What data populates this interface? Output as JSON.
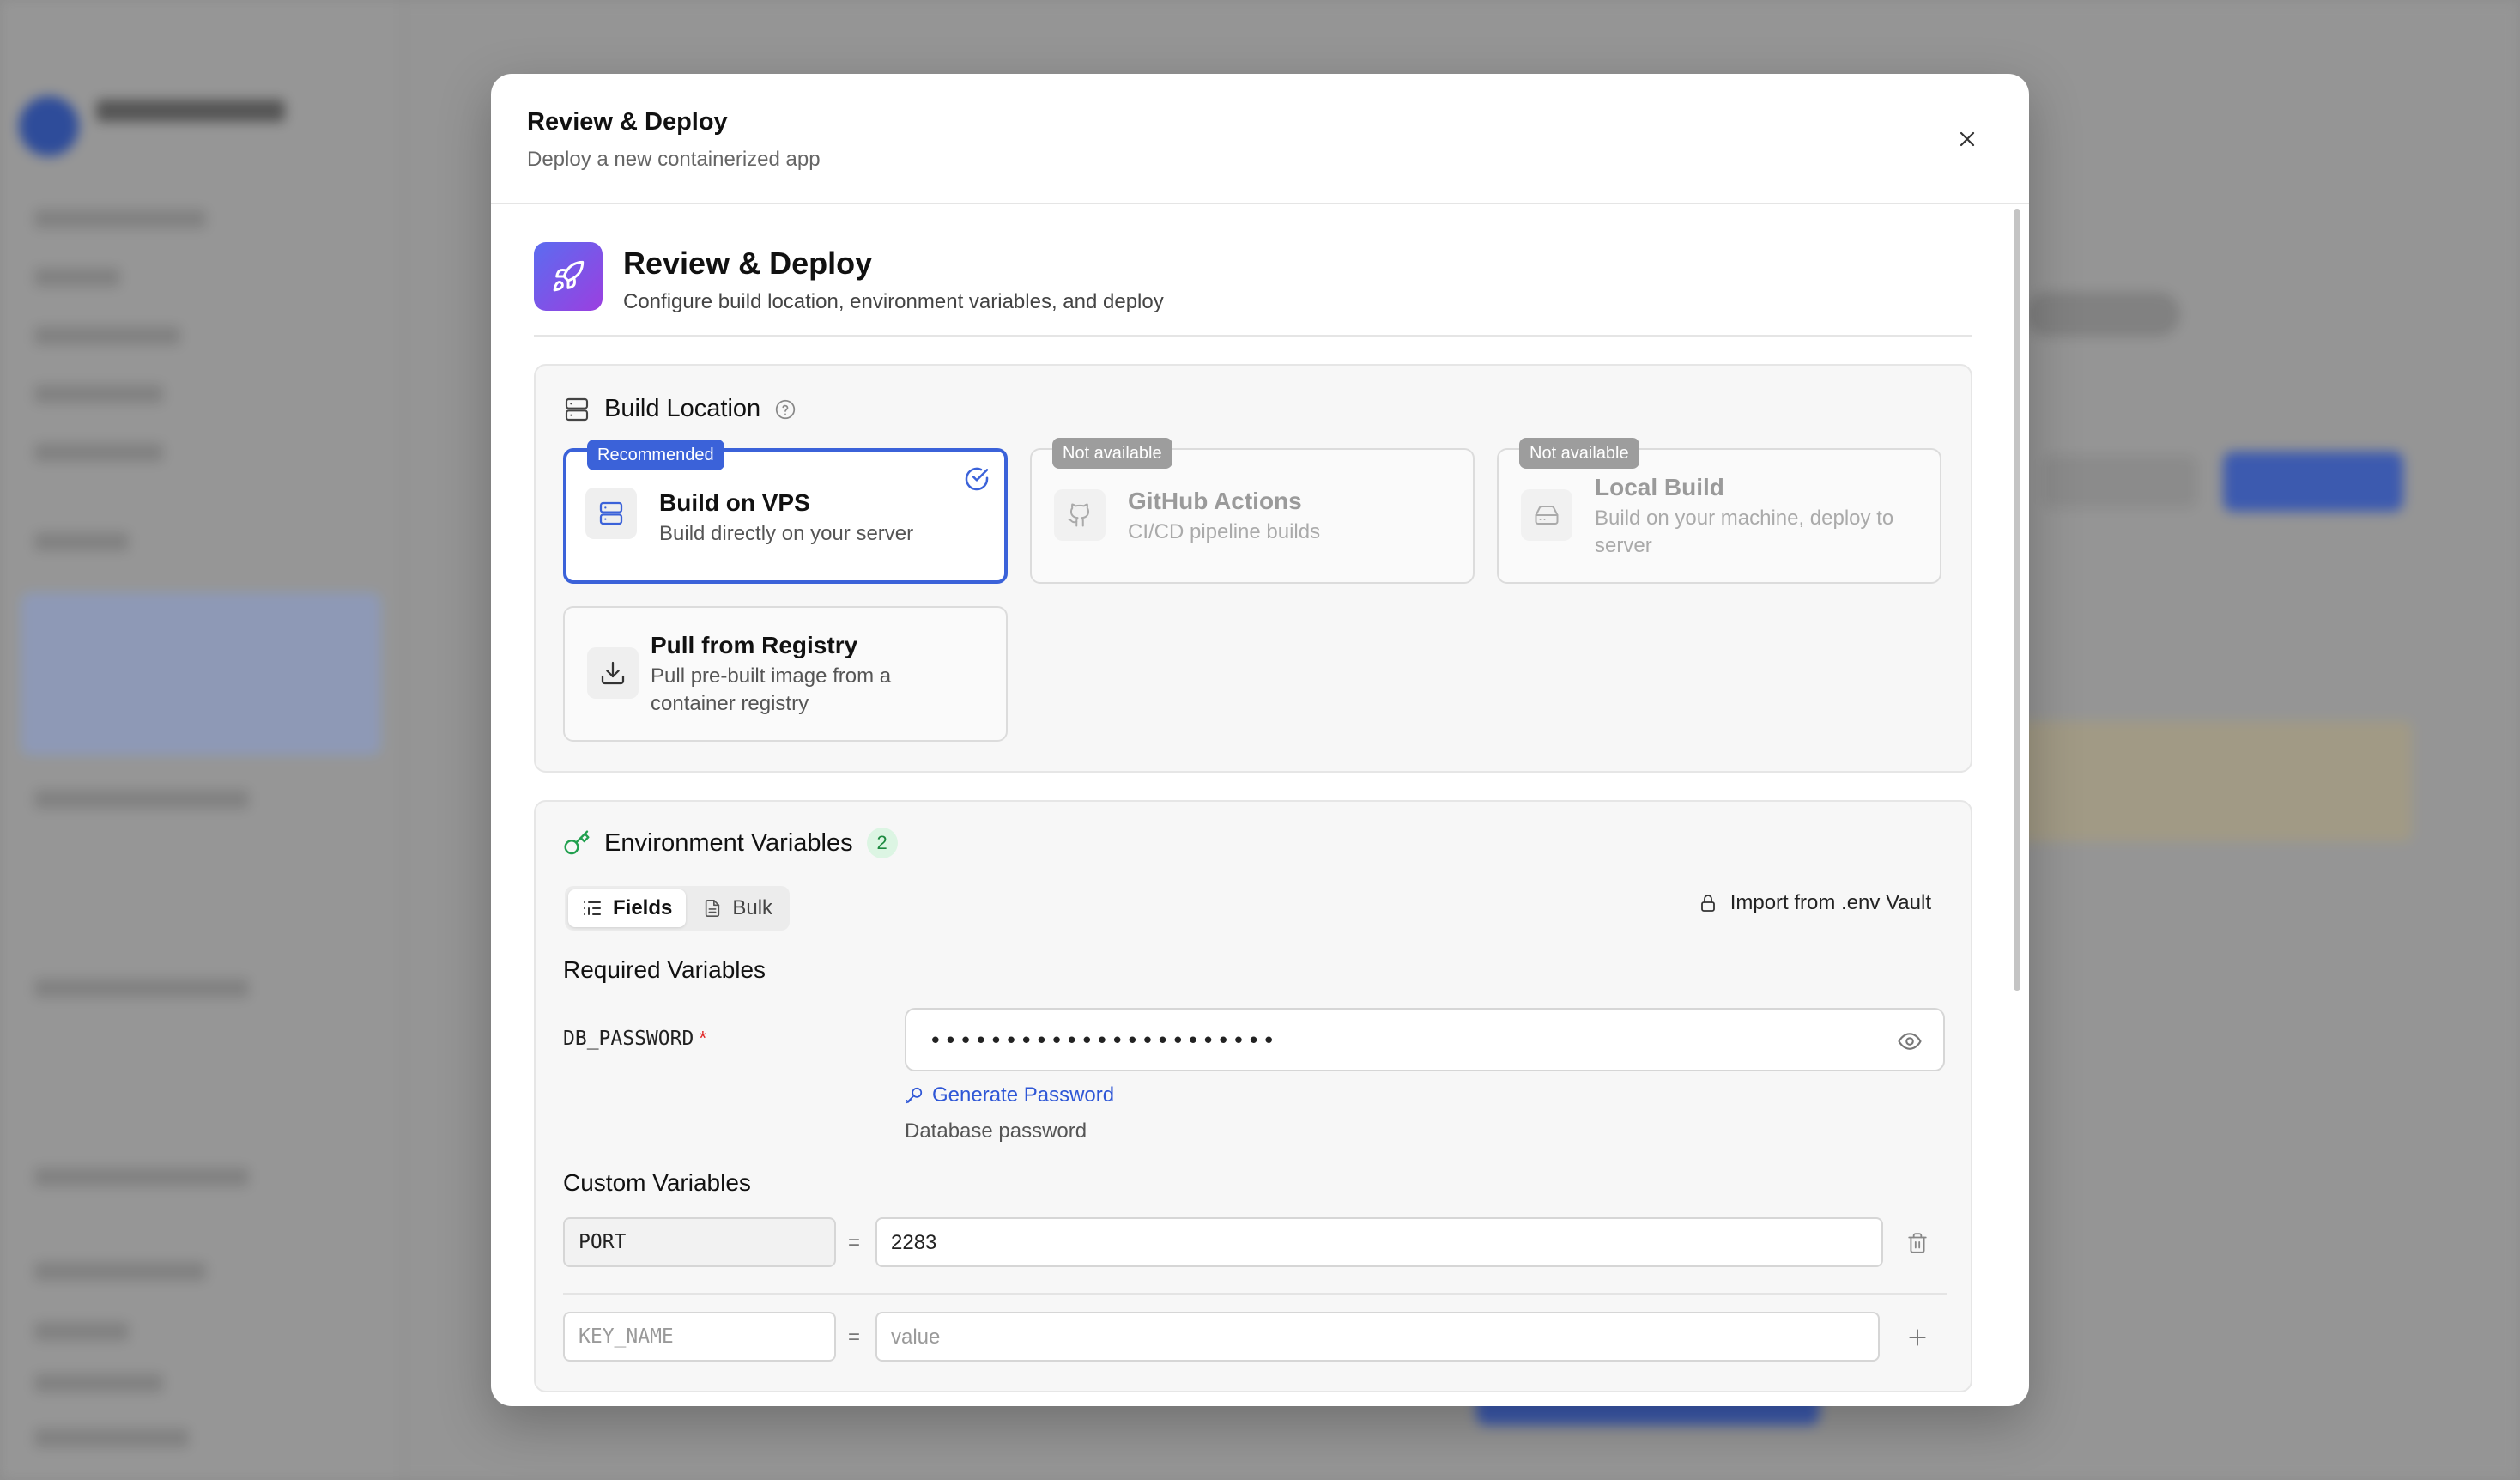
{
  "modal": {
    "title": "Review & Deploy",
    "subtitle": "Deploy a new containerized app",
    "close_icon": "close-icon"
  },
  "intro": {
    "title": "Review & Deploy",
    "description": "Configure build location, environment variables, and deploy",
    "icon": "rocket-icon"
  },
  "build_location": {
    "title": "Build Location",
    "options": [
      {
        "title": "Build on VPS",
        "description": "Build directly on your server",
        "tag": "Recommended",
        "selected": true,
        "available": true,
        "icon": "server-icon"
      },
      {
        "title": "GitHub Actions",
        "description": "CI/CD pipeline builds",
        "tag": "Not available",
        "selected": false,
        "available": false,
        "icon": "github-icon"
      },
      {
        "title": "Local Build",
        "description": "Build on your machine, deploy to server",
        "tag": "Not available",
        "selected": false,
        "available": false,
        "icon": "hard-drive-icon"
      },
      {
        "title": "Pull from Registry",
        "description": "Pull pre-built image from a container registry",
        "tag": "",
        "selected": false,
        "available": true,
        "icon": "download-icon"
      }
    ]
  },
  "env": {
    "title": "Environment Variables",
    "count": "2",
    "tabs": {
      "fields": "Fields",
      "bulk": "Bulk"
    },
    "active_tab": "fields",
    "import_label": "Import from .env Vault",
    "required_heading": "Required Variables",
    "required": [
      {
        "key": "DB_PASSWORD",
        "required_mark": "*",
        "value_masked": "•••••••••••••••••••••••",
        "generate_label": "Generate Password",
        "help": "Database password"
      }
    ],
    "custom_heading": "Custom Variables",
    "custom": [
      {
        "key": "PORT",
        "value": "2283"
      }
    ],
    "new_row": {
      "key_placeholder": "KEY_NAME",
      "value_placeholder": "value",
      "equals": "="
    }
  },
  "colors": {
    "accent": "#3b62d9",
    "link": "#2f57d6",
    "env_badge_bg": "#dcf5e3",
    "env_badge_fg": "#1c8a3f",
    "required_star": "#e02424"
  }
}
